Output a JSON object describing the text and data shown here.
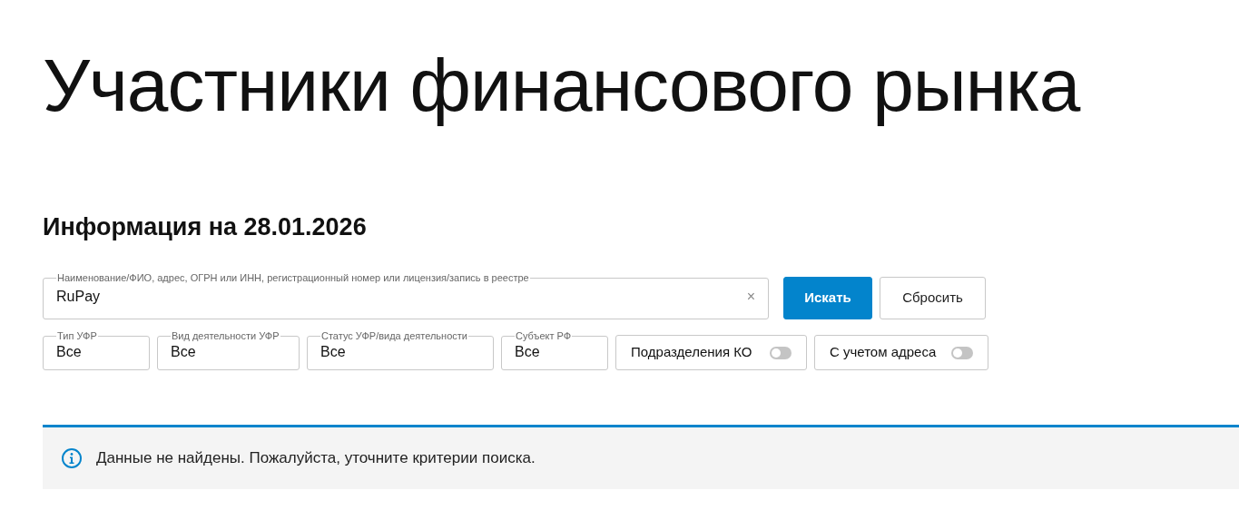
{
  "title": "Участники финансового рынка",
  "subtitle": "Информация на 28.01.2026",
  "search": {
    "label": "Наименование/ФИО, адрес, ОГРН или ИНН, регистрационный номер или лицензия/запись в реестре",
    "value": "RuPay",
    "clear": "×"
  },
  "buttons": [
    {
      "label": "Искать",
      "kind": "primary"
    },
    {
      "label": "Сбросить",
      "kind": "secondary"
    }
  ],
  "filters": [
    {
      "label": "Тип УФР",
      "value": "Все"
    },
    {
      "label": "Вид деятельности УФР",
      "value": "Все"
    },
    {
      "label": "Статус УФР/вида деятельности",
      "value": "Все"
    },
    {
      "label": "Субъект РФ",
      "value": "Все"
    }
  ],
  "toggles": [
    {
      "label": "Подразделения КО",
      "on": false
    },
    {
      "label": "С учетом адреса",
      "on": false
    }
  ],
  "alert": {
    "text": "Данные не найдены. Пожалуйста, уточните критерии поиска."
  }
}
